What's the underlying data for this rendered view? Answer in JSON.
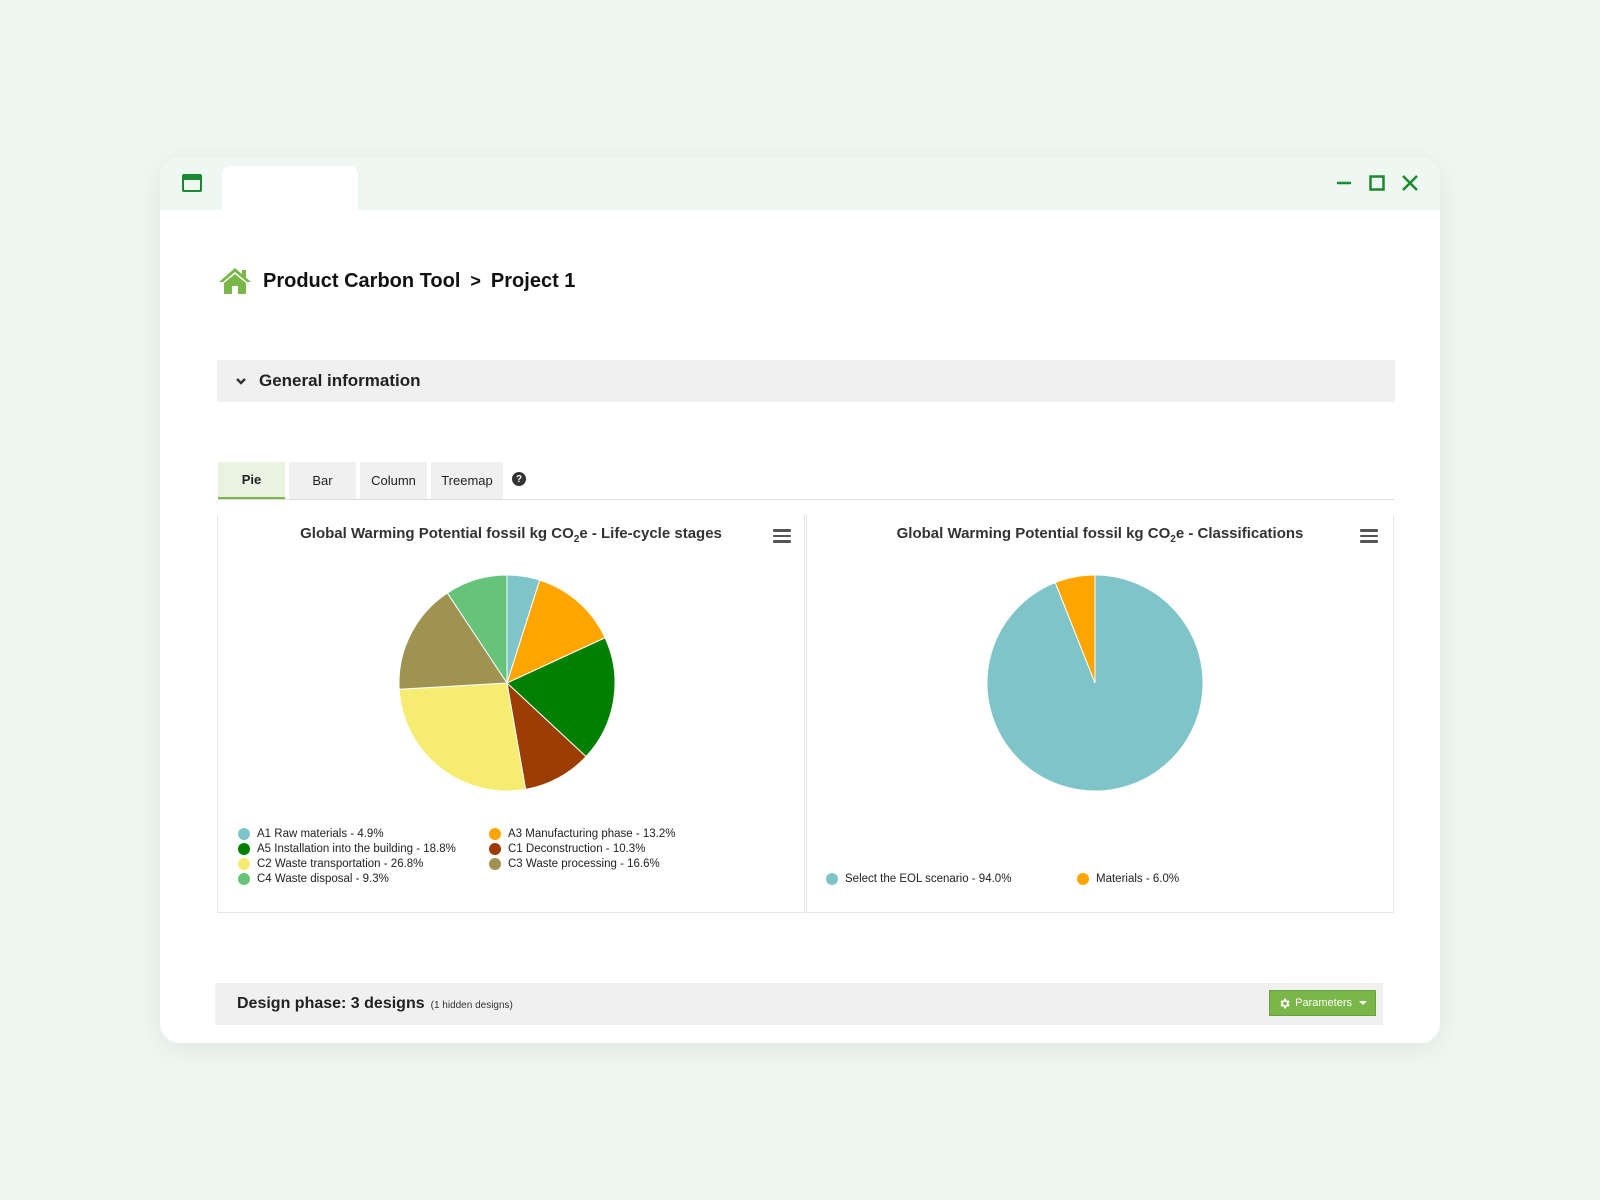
{
  "breadcrumb": {
    "app": "Product Carbon Tool",
    "separator": ">",
    "project": "Project 1"
  },
  "general_section": {
    "label": "General information"
  },
  "chart_tabs": [
    "Pie",
    "Bar",
    "Column",
    "Treemap"
  ],
  "help_icon": "?",
  "charts": {
    "lifecycle": {
      "title_prefix": "Global Warming Potential fossil kg CO",
      "title_sub": "2",
      "title_suffix": "e - Life-cycle stages",
      "legend": [
        "A1 Raw materials - 4.9%",
        "A3 Manufacturing phase - 13.2%",
        "A5 Installation into the building - 18.8%",
        "C1 Deconstruction - 10.3%",
        "C2 Waste transportation - 26.8%",
        "C3 Waste processing - 16.6%",
        "C4 Waste disposal - 9.3%"
      ]
    },
    "classifications": {
      "title_prefix": "Global Warming Potential fossil kg CO",
      "title_sub": "2",
      "title_suffix": "e - Classifications",
      "legend": [
        "Select the EOL scenario - 94.0%",
        "Materials - 6.0%"
      ]
    }
  },
  "chart_data": [
    {
      "type": "pie",
      "title": "Global Warming Potential fossil kg CO2e - Life-cycle stages",
      "categories": [
        "A1 Raw materials",
        "A3 Manufacturing phase",
        "A5 Installation into the building",
        "C1 Deconstruction",
        "C2 Waste transportation",
        "C3 Waste processing",
        "C4 Waste disposal"
      ],
      "values": [
        4.9,
        13.2,
        18.8,
        10.3,
        26.8,
        16.6,
        9.3
      ],
      "colors": [
        "#7ec4c9",
        "#ffa500",
        "#008000",
        "#9b3d00",
        "#f5ec71",
        "#a09352",
        "#66c47a"
      ],
      "legend": "bottom"
    },
    {
      "type": "pie",
      "title": "Global Warming Potential fossil kg CO2e - Classifications",
      "categories": [
        "Select the EOL scenario",
        "Materials"
      ],
      "values": [
        94.0,
        6.0
      ],
      "colors": [
        "#7ec4c9",
        "#ffa500"
      ],
      "legend": "bottom"
    }
  ],
  "design_phase": {
    "title": "Design phase: 3 designs",
    "hidden_note": "(1 hidden designs)",
    "params_label": "Parameters"
  },
  "colors": {
    "accent": "#7ab648",
    "brand": "#1a8a2e",
    "window_bg": "#eef7f1"
  }
}
